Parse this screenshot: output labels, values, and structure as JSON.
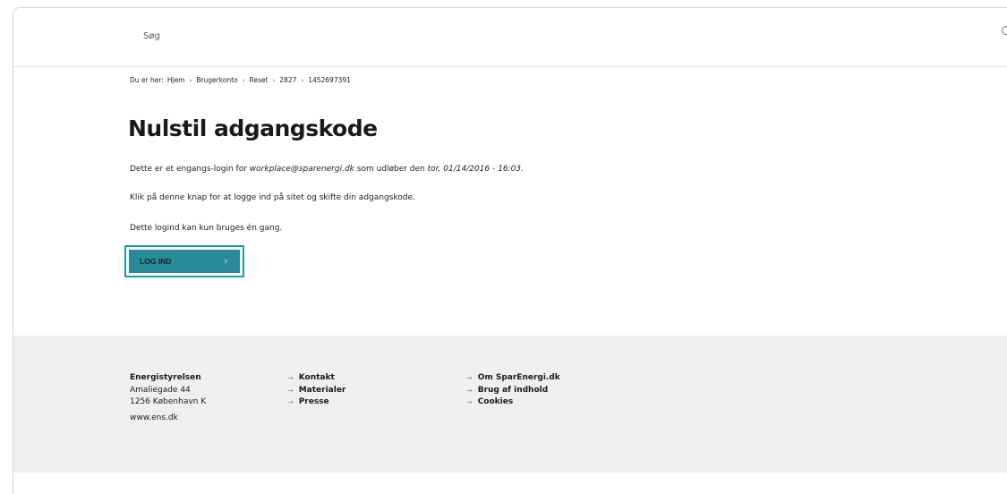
{
  "header": {
    "search_label": "Søg"
  },
  "breadcrumb": {
    "prefix": "Du er her:",
    "items": [
      "Hjem",
      "Brugerkonto",
      "Reset",
      "2827",
      "1452697391"
    ]
  },
  "main": {
    "title": "Nulstil adgangskode",
    "p1_before": "Dette er et engangs-login for ",
    "p1_email": "workplace@sparenergi.dk",
    "p1_middle": " som udløber den ",
    "p1_date": "tor, 01/14/2016 - 16:03.",
    "p2": "Klik på denne knap for at logge ind på sitet og skifte din adgangskode.",
    "p3": "Dette logind kan kun bruges én gang.",
    "login_label": "LOG IND",
    "chevron": "›"
  },
  "footer": {
    "org_name": "Energistyrelsen",
    "address1": "Amaliegade 44",
    "address2": "1256 København K",
    "website": "www.ens.dk",
    "col2": [
      "Kontakt",
      "Materialer",
      "Presse"
    ],
    "col3": [
      "Om SparEnergi.dk",
      "Brug af indhold",
      "Cookies"
    ]
  },
  "colors": {
    "accent": "#1a98ad",
    "button": "#2a8a97",
    "footer_bg": "#eeefee"
  }
}
